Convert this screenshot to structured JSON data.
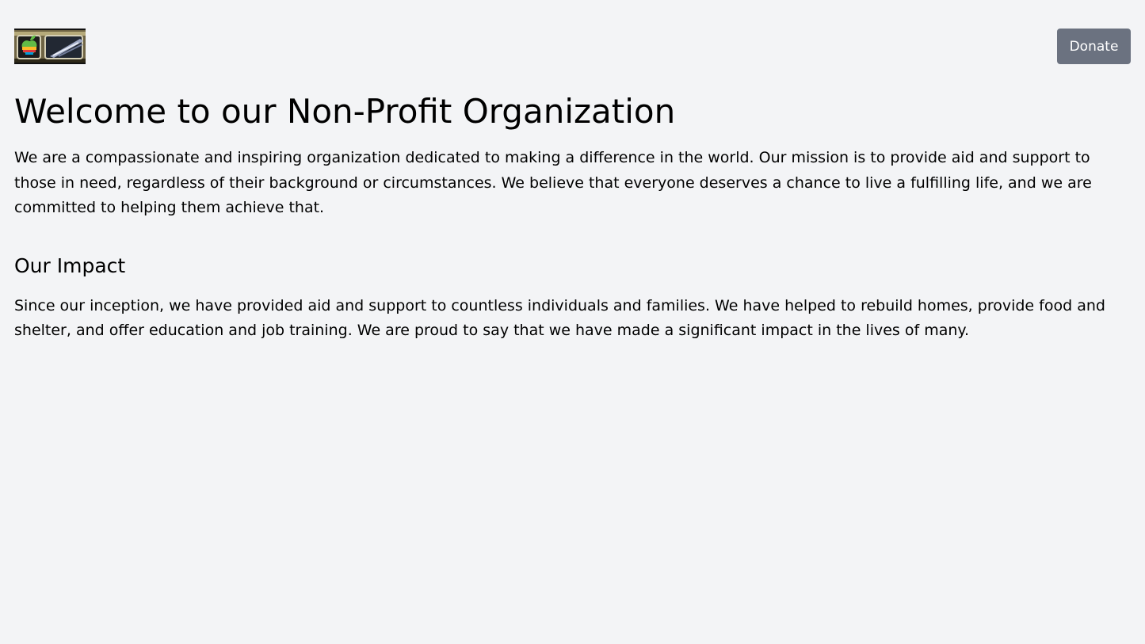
{
  "header": {
    "logo_alt": "Apple logo",
    "donate_label": "Donate"
  },
  "main": {
    "title": "Welcome to our Non-Profit Organization",
    "intro": "We are a compassionate and inspiring organization dedicated to making a difference in the world. Our mission is to provide aid and support to those in need, regardless of their background or circumstances. We believe that everyone deserves a chance to live a fulfilling life, and we are committed to helping them achieve that.",
    "impact_heading": "Our Impact",
    "impact_text": "Since our inception, we have provided aid and support to countless individuals and families. We have helped to rebuild homes, provide food and shelter, and offer education and job training. We are proud to say that we have made a significant impact in the lives of many."
  },
  "colors": {
    "background": "#f3f4f6",
    "button_background": "#6b7280",
    "button_text": "#ffffff",
    "text": "#000000"
  }
}
